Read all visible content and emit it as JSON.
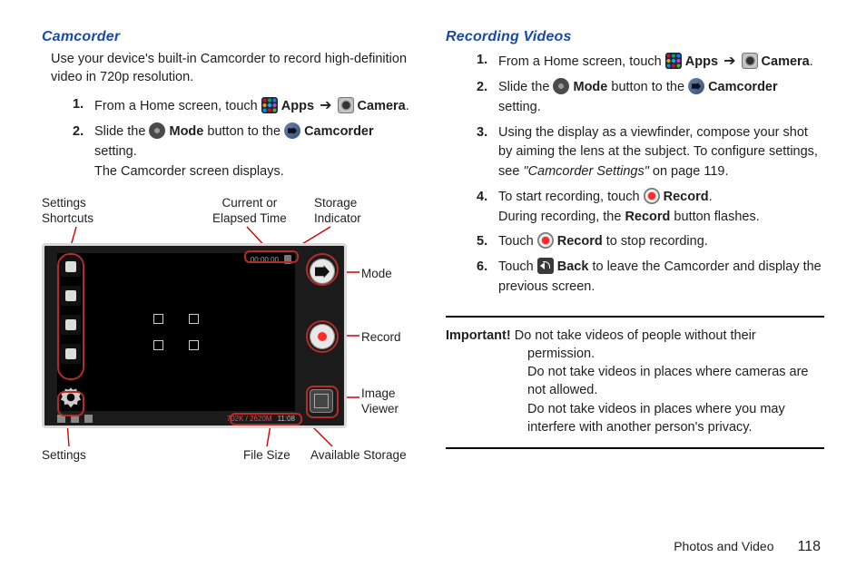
{
  "left": {
    "heading": "Camcorder",
    "lead": "Use your device's built-in Camcorder to record high-definition video in 720p resolution.",
    "step1_a": "From a Home screen, touch",
    "apps_label": "Apps",
    "arrow": "➔",
    "camera_label": "Camera",
    "step2_a": "Slide the",
    "mode_label": "Mode",
    "step2_b": "button to the",
    "camcorder_label": "Camcorder",
    "step2_c": "setting.",
    "step2_d": "The Camcorder screen displays."
  },
  "diagram": {
    "labels": {
      "settings_shortcuts": "Settings\nShortcuts",
      "time": "Current or\nElapsed Time",
      "storage": "Storage\nIndicator",
      "mode": "Mode",
      "record": "Record",
      "viewer": "Image\nViewer",
      "settings": "Settings",
      "file_size": "File Size",
      "avail": "Available Storage"
    },
    "topbar_time": "00:00:00",
    "filesize": "702K / 2620M",
    "clock": "11:08"
  },
  "right": {
    "heading": "Recording Videos",
    "s1_a": "From a Home screen, touch",
    "apps_label": "Apps",
    "arrow": "➔",
    "camera_label": "Camera",
    "s2_a": "Slide the",
    "mode_label": "Mode",
    "s2_b": "button to the",
    "camcorder_label": "Camcorder",
    "s2_c": "setting.",
    "s3": "Using the display as a viewfinder, compose your shot by aiming the lens at the subject. To configure settings, see ",
    "s3_ref": "\"Camcorder Settings\"",
    "s3_tail": " on page 119.",
    "s4_a": "To start recording, touch",
    "record_label": "Record",
    "s4_b": "During recording, the ",
    "s4_c": " button flashes.",
    "s5_a": "Touch",
    "s5_b": " to stop recording.",
    "s6_a": "Touch",
    "back_label": "Back",
    "s6_b": " to leave the Camcorder and display the previous screen."
  },
  "important": {
    "lead": "Important!",
    "l1": "Do not take videos of people without their permission.",
    "l2": "Do not take videos in places where cameras are not allowed.",
    "l3": "Do not take videos in places where you may interfere with another person's privacy."
  },
  "footer": {
    "section": "Photos and Video",
    "page": "118"
  }
}
